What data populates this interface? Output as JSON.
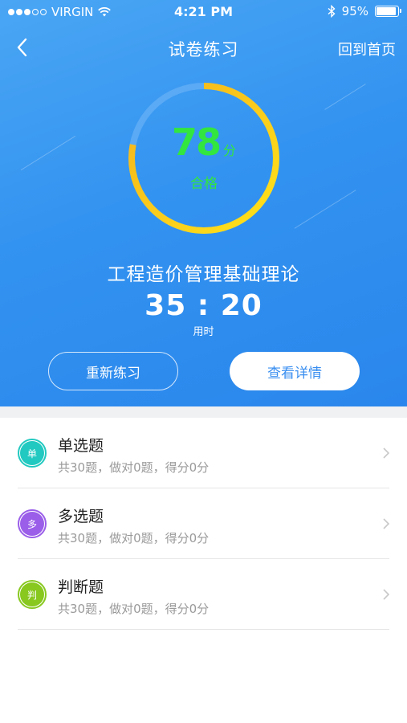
{
  "status_bar": {
    "carrier": "VIRGIN",
    "time": "4:21 PM",
    "battery": "95%",
    "signal_bars": 3
  },
  "nav": {
    "title": "试卷练习",
    "home_label": "回到首页"
  },
  "result": {
    "score": "78",
    "score_unit": "分",
    "status": "合格",
    "progress": 0.78
  },
  "exam": {
    "subject": "工程造价管理基础理论",
    "elapsed": "35 : 20",
    "elapsed_label": "用时"
  },
  "actions": {
    "retry_label": "重新练习",
    "detail_label": "查看详情"
  },
  "sections": [
    {
      "badge": "单",
      "name": "单选题",
      "desc": "共30题，做对0题，得分0分",
      "color": "#21c9c0"
    },
    {
      "badge": "多",
      "name": "多选题",
      "desc": "共30题，做对0题，得分0分",
      "color": "#9a5ee9"
    },
    {
      "badge": "判",
      "name": "判断题",
      "desc": "共30题，做对0题，得分0分",
      "color": "#88c81f"
    }
  ],
  "colors": {
    "accent": "#3393f0",
    "ring_track": "#5aaaf5",
    "ring_start": "#ffe31a",
    "ring_end": "#f5b21c",
    "score": "#33e63f"
  }
}
